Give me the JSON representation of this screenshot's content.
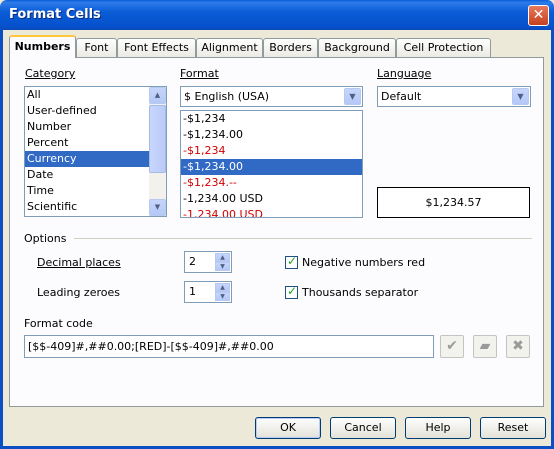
{
  "window": {
    "title": "Format Cells",
    "close_glyph": "✕"
  },
  "tabs": [
    {
      "label": "Numbers",
      "active": true
    },
    {
      "label": "Font"
    },
    {
      "label": "Font Effects"
    },
    {
      "label": "Alignment"
    },
    {
      "label": "Borders"
    },
    {
      "label": "Background"
    },
    {
      "label": "Cell Protection"
    }
  ],
  "category": {
    "label": "Category",
    "items": [
      "All",
      "User-defined",
      "Number",
      "Percent",
      "Currency",
      "Date",
      "Time",
      "Scientific"
    ],
    "selected": "Currency"
  },
  "format": {
    "label": "Format",
    "combo_value": "$ English (USA)",
    "items": [
      {
        "text": "-$1,234",
        "red": false
      },
      {
        "text": "-$1,234.00",
        "red": false
      },
      {
        "text": "-$1,234",
        "red": true
      },
      {
        "text": "-$1,234.00",
        "red": true,
        "selected": true
      },
      {
        "text": "-$1,234.--",
        "red": true
      },
      {
        "text": "-1,234.00 USD",
        "red": false
      },
      {
        "text": "-1,234.00 USD",
        "red": true
      }
    ]
  },
  "language": {
    "label": "Language",
    "value": "Default"
  },
  "preview": {
    "value": "$1,234.57"
  },
  "options": {
    "label": "Options",
    "decimal_places_label": "Decimal places",
    "decimal_places_value": "2",
    "leading_zeroes_label": "Leading zeroes",
    "leading_zeroes_value": "1",
    "negative_red_label": "Negative numbers red",
    "negative_red_checked": true,
    "thousands_sep_label": "Thousands separator",
    "thousands_sep_checked": true
  },
  "format_code": {
    "label": "Format code",
    "value": "[$$-409]#,##0.00;[RED]-[$$-409]#,##0.00"
  },
  "buttons": {
    "ok": "OK",
    "cancel": "Cancel",
    "help": "Help",
    "reset": "Reset"
  },
  "icons": {
    "apply": "checkmark-icon",
    "comment": "comment-icon",
    "remove": "delete-x-icon"
  },
  "colors": {
    "selection": "#316ac5",
    "negative_red": "#d00000",
    "titlebar": "#0a5cd6"
  }
}
